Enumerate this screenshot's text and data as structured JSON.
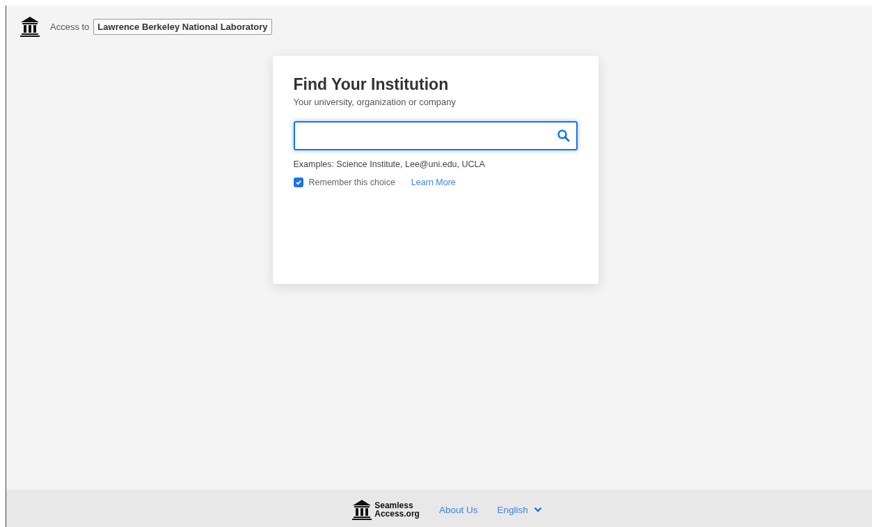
{
  "header": {
    "access_label": "Access to",
    "organization": "Lawrence Berkeley National Laboratory"
  },
  "card": {
    "title": "Find Your Institution",
    "subtitle": "Your university, organization or company",
    "examples": "Examples: Science Institute, Lee@uni.edu, UCLA",
    "remember": {
      "label": "Remember this choice",
      "checked": true
    },
    "learn_more": "Learn More"
  },
  "footer": {
    "logo_lines": [
      "Seamless",
      "Access.org"
    ],
    "links": [
      "About Us"
    ],
    "language": "English"
  }
}
